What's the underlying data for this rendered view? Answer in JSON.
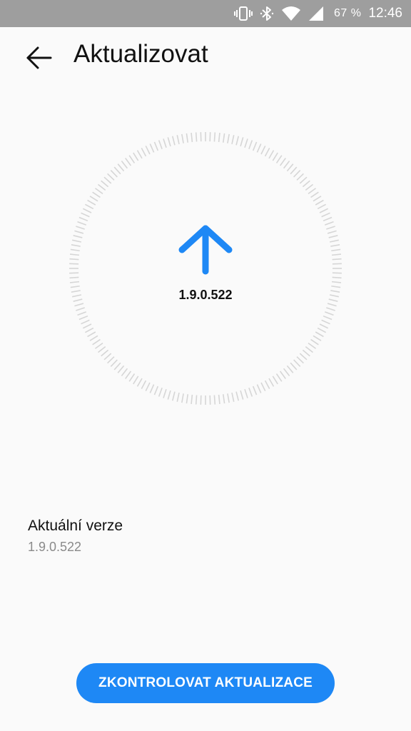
{
  "status_bar": {
    "battery": "67 %",
    "time": "12:46",
    "icons": [
      "vibrate-icon",
      "bluetooth-icon",
      "wifi-icon",
      "signal-icon"
    ]
  },
  "header": {
    "title": "Aktualizovat",
    "back_icon": "arrow-left-icon"
  },
  "dial": {
    "icon": "arrow-up-icon",
    "version": "1.9.0.522"
  },
  "current": {
    "label": "Aktuální verze",
    "value": "1.9.0.522"
  },
  "actions": {
    "check_label": "ZKONTROLOVAT AKTUALIZACE"
  },
  "colors": {
    "accent": "#1e88f5",
    "status_bar": "#9e9e9e",
    "background": "#fafafa",
    "tick": "#d6d6d6"
  }
}
